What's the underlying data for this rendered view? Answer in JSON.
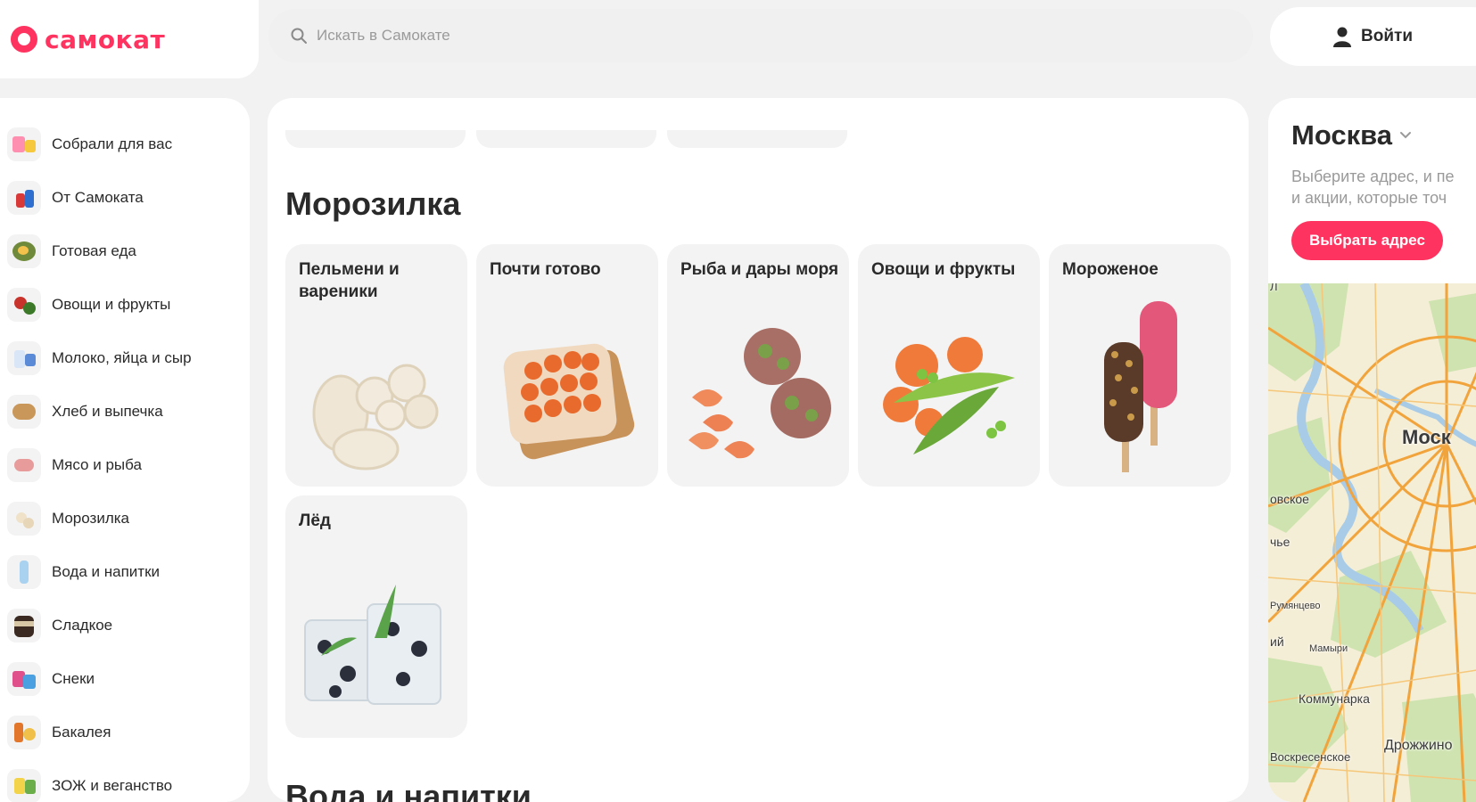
{
  "header": {
    "logo_text": "самокат",
    "search_placeholder": "Искать в Самокате",
    "login_label": "Войти"
  },
  "sidebar": {
    "items": [
      {
        "label": "Собрали для вас",
        "icon": "collection-icon"
      },
      {
        "label": "От Самоката",
        "icon": "own-brand-icon"
      },
      {
        "label": "Готовая еда",
        "icon": "ready-food-icon"
      },
      {
        "label": "Овощи и фрукты",
        "icon": "vegetables-icon"
      },
      {
        "label": "Молоко, яйца и сыр",
        "icon": "dairy-icon"
      },
      {
        "label": "Хлеб и выпечка",
        "icon": "bread-icon"
      },
      {
        "label": "Мясо и рыба",
        "icon": "meat-icon"
      },
      {
        "label": "Морозилка",
        "icon": "frozen-icon"
      },
      {
        "label": "Вода и напитки",
        "icon": "drinks-icon"
      },
      {
        "label": "Сладкое",
        "icon": "sweets-icon"
      },
      {
        "label": "Снеки",
        "icon": "snacks-icon"
      },
      {
        "label": "Бакалея",
        "icon": "grocery-icon"
      },
      {
        "label": "ЗОЖ и веганство",
        "icon": "healthy-icon"
      }
    ]
  },
  "main": {
    "section_title": "Морозилка",
    "next_section_title": "Вода и напитки",
    "cards": [
      {
        "label": "Пельмени и вареники",
        "icon": "dumplings-image"
      },
      {
        "label": "Почти готово",
        "icon": "pizza-image"
      },
      {
        "label": "Рыба и дары моря",
        "icon": "seafood-image"
      },
      {
        "label": "Овощи и фрукты",
        "icon": "frozen-vegetables-image"
      },
      {
        "label": "Мороженое",
        "icon": "ice-cream-image"
      },
      {
        "label": "Лёд",
        "icon": "ice-image"
      }
    ]
  },
  "location": {
    "city": "Москва",
    "hint": "Выберите адрес, и пе\nи акции, которые точ",
    "hint_line1": "Выберите адрес, и пе",
    "hint_line2": "и акции, которые точ",
    "button_label": "Выбрать адрес",
    "map_labels": {
      "city": "Моск",
      "l1": "овское",
      "l2": "чье",
      "l3": "Румянцево",
      "l4": "ий",
      "l5": "Мамыри",
      "l6": "Коммунарка",
      "l7": "Дрожжино",
      "l8": "Воскресенское",
      "l9": "Л"
    }
  },
  "colors": {
    "accent": "#ff335f",
    "page_bg": "#f2f2f2",
    "card_bg": "#f3f3f3"
  }
}
